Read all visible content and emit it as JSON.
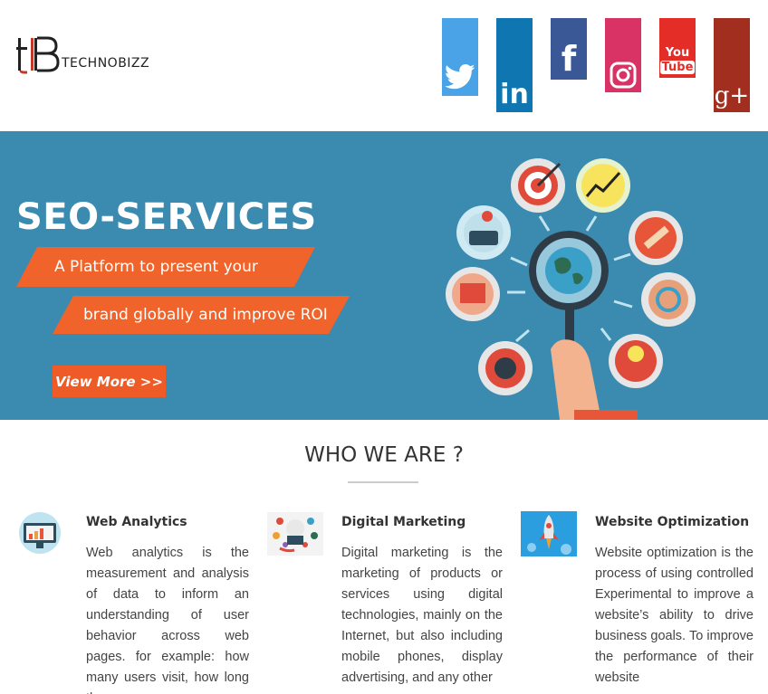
{
  "brand": {
    "logo_text": "TECHNOBIZZ"
  },
  "social": [
    {
      "name": "twitter",
      "icon": "twitter-icon",
      "color": "#4aa3e6"
    },
    {
      "name": "linkedin",
      "icon": "linkedin-icon",
      "color": "#0f76b1",
      "label": "in"
    },
    {
      "name": "facebook",
      "icon": "facebook-icon",
      "color": "#3b5896",
      "label": "f"
    },
    {
      "name": "instagram",
      "icon": "instagram-icon",
      "color": "#d93366"
    },
    {
      "name": "youtube",
      "icon": "youtube-icon",
      "color": "#e52d27",
      "label_top": "You",
      "label_bottom": "Tube"
    },
    {
      "name": "google-plus",
      "icon": "google-plus-icon",
      "color": "#a12e1e",
      "label": "g+"
    }
  ],
  "banner": {
    "title": "SEO-SERVICES",
    "ribbon_1": "A Platform to present your",
    "ribbon_2": "brand globally and improve ROI",
    "cta": "View More >>",
    "background": "#3b8bb0",
    "accent": "#f0632a"
  },
  "who_we_are": {
    "title": "WHO WE ARE ?",
    "features": [
      {
        "title": "Web Analytics",
        "icon": "analytics-monitor-icon",
        "text": "Web analytics is the measurement and analysis of data to inform an understanding of user behavior across web pages. for example: how many users visit, how long they"
      },
      {
        "title": "Digital Marketing",
        "icon": "digital-marketing-icon",
        "text": "Digital marketing is the marketing of products or services using digital technologies, mainly on the Internet, but also including mobile phones, display advertising, and any other"
      },
      {
        "title": "Website Optimization",
        "icon": "rocket-icon",
        "text": "Website optimization is the process of using controlled Experimental to improve a website’s ability to drive business goals. To improve the performance of their website"
      }
    ]
  }
}
